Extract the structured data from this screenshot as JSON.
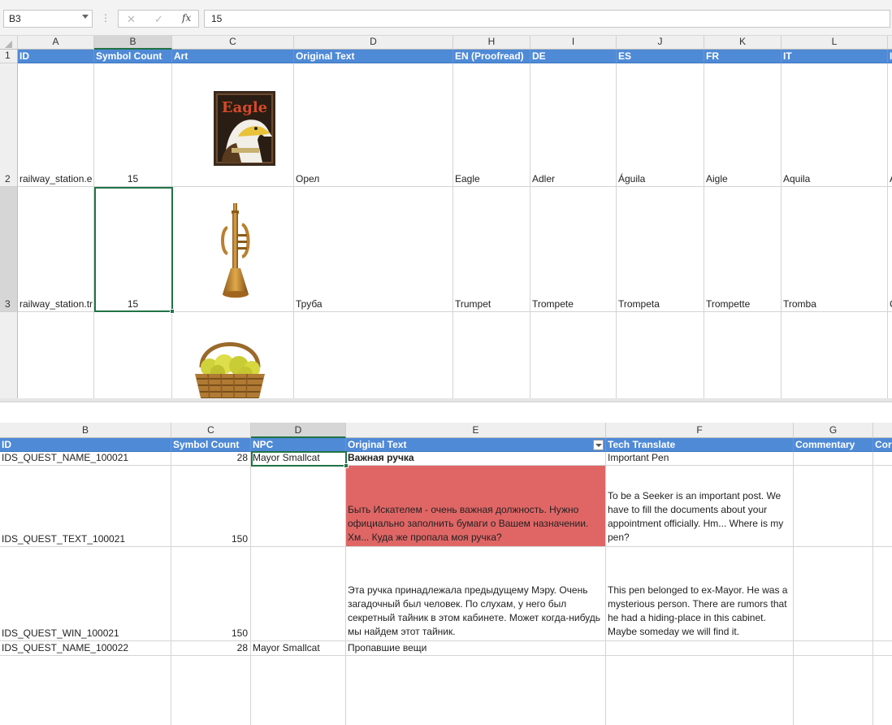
{
  "formula_bar": {
    "name_box": "B3",
    "cancel_glyph": "✕",
    "enter_glyph": "✓",
    "fx_label": "fx",
    "formula_value": "15"
  },
  "sheet1": {
    "columns": [
      "A",
      "B",
      "C",
      "D",
      "H",
      "I",
      "J",
      "K",
      "L",
      ""
    ],
    "rows": [
      "1",
      "2",
      "3",
      ""
    ],
    "headers": [
      "ID",
      "Symbol Count",
      "Art",
      "Original Text",
      "EN (Proofread)",
      "DE",
      "ES",
      "FR",
      "IT",
      "I"
    ],
    "data": [
      {
        "id": "railway_station.e",
        "count": "15",
        "art": "eagle-poster-image",
        "original": "Орел",
        "en": "Eagle",
        "de": "Adler",
        "es": "Águila",
        "fr": "Aigle",
        "it": "Aquila",
        "extra": "A"
      },
      {
        "id": "railway_station.tr",
        "count": "15",
        "art": "trumpet-image",
        "original": "Труба",
        "en": "Trumpet",
        "de": "Trompete",
        "es": "Trompeta",
        "fr": "Trompette",
        "it": "Tromba",
        "extra": "C"
      },
      {
        "id": "",
        "count": "",
        "art": "apple-basket-image",
        "original": "",
        "en": "",
        "de": "",
        "es": "",
        "fr": "",
        "it": "",
        "extra": ""
      }
    ],
    "eagle_poster_title": "Eagle"
  },
  "sheet2": {
    "columns": [
      "B",
      "C",
      "D",
      "E",
      "F",
      "G",
      ""
    ],
    "headers": [
      "ID",
      "Symbol Count",
      "NPC",
      "Original Text",
      "Tech Translate",
      "Commentary",
      "Cor"
    ],
    "rows": [
      {
        "id": "IDS_QUEST_NAME_100021",
        "count": "28",
        "npc": "Mayor Smallcat",
        "original": "Важная ручка",
        "tech": "Important Pen",
        "comment": ""
      },
      {
        "id": "IDS_QUEST_TEXT_100021",
        "count": "150",
        "npc": "",
        "original": "Быть Искателем - очень важная должность. Нужно официально заполнить бумаги о Вашем назначении. Хм... Куда же пропала моя ручка?",
        "tech": "To be a Seeker is an important post. We have to fill the documents about your appointment officially. Hm... Where is my pen?",
        "comment": ""
      },
      {
        "id": "IDS_QUEST_WIN_100021",
        "count": "150",
        "npc": "",
        "original": "Эта ручка принадлежала предыдущему Мэру. Очень загадочный был человек. По слухам, у него был секретный тайник в этом кабинете. Может когда-нибудь мы найдем этот тайник.",
        "tech": "This pen belonged to ex-Mayor. He was a mysterious person. There are rumors that he had a hiding-place in this cabinet. Maybe someday we will find it.",
        "comment": ""
      },
      {
        "id": "IDS_QUEST_NAME_100022",
        "count": "28",
        "npc": "Mayor Smallcat",
        "original": "Пропавшие вещи",
        "tech": "",
        "comment": ""
      }
    ]
  },
  "colors": {
    "header_blue": "#4f8ad6",
    "highlight_red": "#e06666",
    "selection_green": "#217346"
  }
}
